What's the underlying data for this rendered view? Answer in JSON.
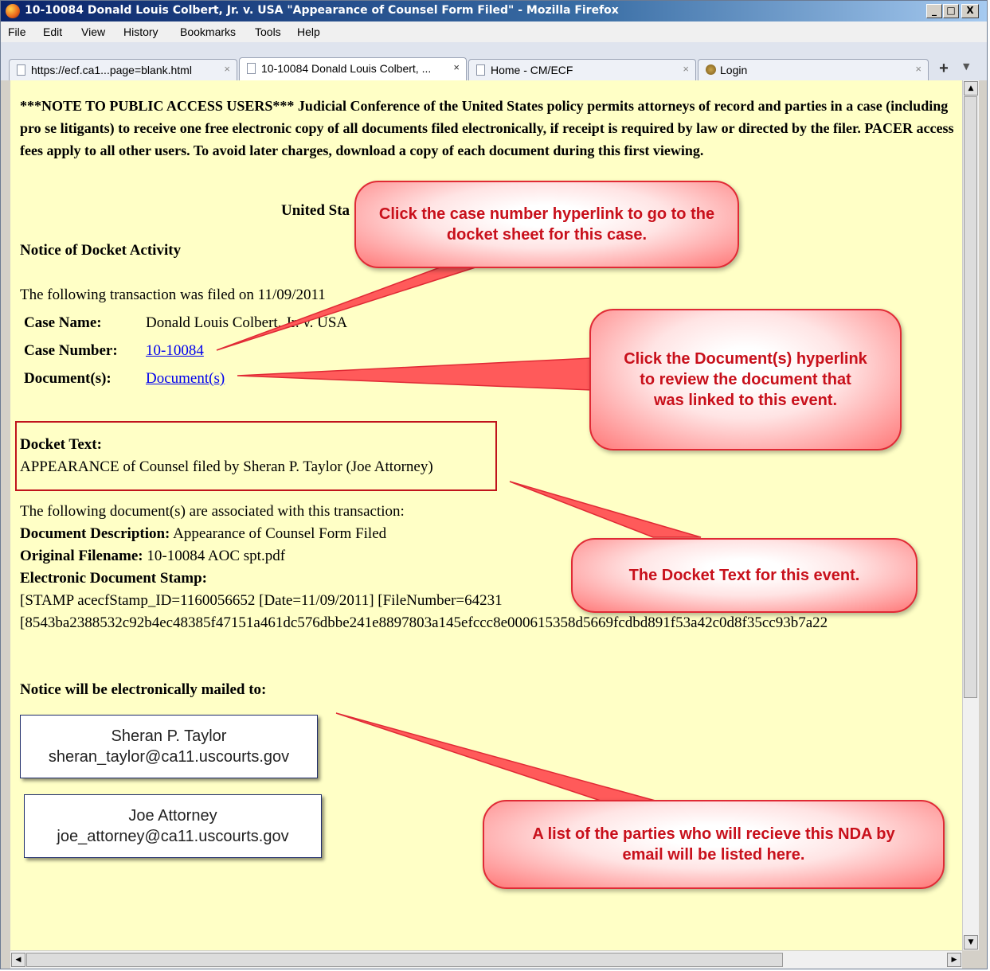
{
  "window": {
    "title": "10-10084 Donald Louis Colbert, Jr. v. USA \"Appearance of Counsel Form Filed\" - Mozilla Firefox",
    "minimize": "_",
    "maximize": "□",
    "close": "X"
  },
  "menu": [
    "File",
    "Edit",
    "View",
    "History",
    "Bookmarks",
    "Tools",
    "Help"
  ],
  "tabs": [
    {
      "label": "https://ecf.ca1...page=blank.html",
      "close": "×"
    },
    {
      "label": "10-10084 Donald Louis Colbert, ...",
      "close": "×"
    },
    {
      "label": "Home - CM/ECF",
      "close": "×"
    },
    {
      "label": "Login",
      "close": "×"
    }
  ],
  "new_tab": "+",
  "page": {
    "notice": "***NOTE TO PUBLIC ACCESS USERS*** Judicial Conference of the United States policy permits attorneys of record and parties in a case (including pro se litigants) to receive one free electronic copy of all documents filed electronically, if receipt is required by law or directed by the filer. PACER access fees apply to all other users. To avoid later charges, download a copy of each document during this first viewing.",
    "court_partial": "United Sta",
    "heading": "Notice of Docket Activity",
    "filed_on": "The following transaction was filed on 11/09/2011",
    "case_name_label": "Case Name:",
    "case_name_value": "Donald Louis Colbert, Jr. v. USA",
    "case_number_label": "Case Number:",
    "case_number_value": "10-10084",
    "documents_label": "Document(s):",
    "documents_value": "Document(s)",
    "docket_text_label": "Docket Text:",
    "docket_text_value": "APPEARANCE of Counsel filed by Sheran P. Taylor (Joe Attorney)",
    "associated": "The following document(s) are associated with this transaction:",
    "doc_desc_label": "Document Description:",
    "doc_desc_value": "Appearance of Counsel Form Filed",
    "orig_filename_label": "Original Filename:",
    "orig_filename_value": "10-10084 AOC spt.pdf",
    "stamp_label": "Electronic Document Stamp:",
    "stamp_line1": "[STAMP acecfStamp_ID=1160056652 [Date=11/09/2011] [FileNumber=64231",
    "stamp_line2": "[8543ba2388532c92b4ec48385f47151a461dc576dbbe241e8897803a145efccc8e000615358d5669fcdbd891f53a42c0d8f35cc93b7a22",
    "mailed_to": "Notice will be electronically mailed to:",
    "parties": [
      {
        "name": "Sheran P. Taylor",
        "email": "sheran_taylor@ca11.uscourts.gov"
      },
      {
        "name": "Joe Attorney",
        "email": "joe_attorney@ca11.uscourts.gov"
      }
    ]
  },
  "callouts": {
    "case_number": "Click the case number hyperlink to go to the docket sheet for this case.",
    "documents": "Click the Document(s) hyperlink to review the document that was linked to this event.",
    "docket_text": "The Docket Text for this event.",
    "parties": "A list of the parties who will recieve this NDA by email will be listed here."
  },
  "colors": {
    "callout_text": "#c8101b",
    "page_bg": "#ffffc6",
    "link": "#0000ee"
  }
}
